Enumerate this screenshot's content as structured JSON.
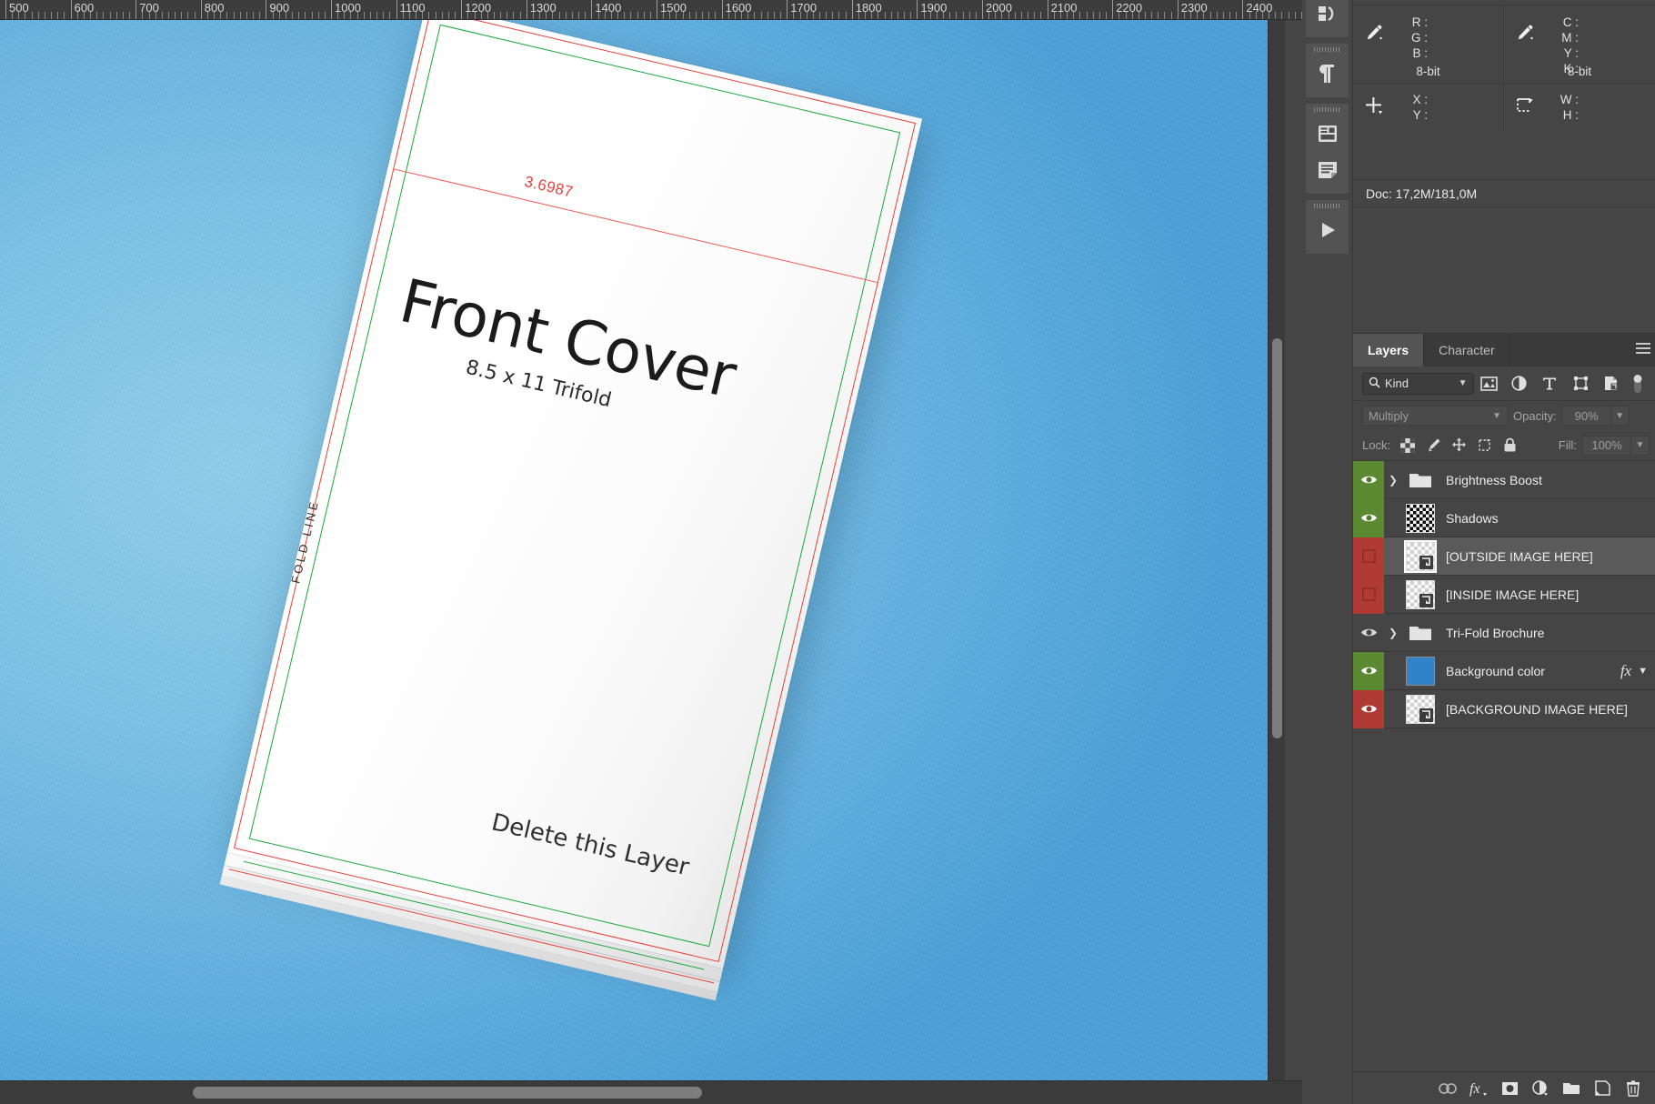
{
  "ruler": {
    "unit_start": 500,
    "unit_end": 2400,
    "step": 100,
    "labels": [
      "500",
      "600",
      "700",
      "800",
      "900",
      "1000",
      "1100",
      "1200",
      "1300",
      "1400",
      "1500",
      "1600",
      "1700",
      "1800",
      "1900",
      "2000",
      "2100",
      "2200",
      "2300",
      "2400"
    ]
  },
  "document": {
    "background_color": "#7cc0e4",
    "brochure": {
      "title": "Front Cover",
      "subtitle": "8.5 x 11 Trifold",
      "measure_label": "3.6987",
      "fold_line_label": "FOLD LINE",
      "delete_layer_note": "Delete this Layer",
      "guide_colors": {
        "bleed": "#e8413a",
        "safe": "#19a83c"
      }
    }
  },
  "icon_dock": {
    "items": [
      {
        "name": "history-icon",
        "label": "History"
      },
      {
        "name": "paragraph-icon",
        "label": "Paragraph"
      },
      {
        "name": "properties-icon",
        "label": "Properties"
      },
      {
        "name": "notes-icon",
        "label": "Notes"
      },
      {
        "name": "timeline-icon",
        "label": "Timeline"
      }
    ]
  },
  "info_panel": {
    "rgb": {
      "labels": [
        "R :",
        "G :",
        "B :"
      ],
      "depth": "8-bit"
    },
    "cmyk": {
      "labels": [
        "C :",
        "M :",
        "Y :",
        "K :"
      ],
      "depth": "8-bit"
    },
    "position": {
      "labels": [
        "X :",
        "Y :"
      ]
    },
    "dimensions": {
      "labels": [
        "W :",
        "H :"
      ]
    },
    "doc_size": "Doc: 17,2M/181,0M"
  },
  "layers_panel": {
    "tabs": [
      {
        "label": "Layers",
        "active": true
      },
      {
        "label": "Character",
        "active": false
      }
    ],
    "menu_icon": "panel-menu-icon",
    "filter": {
      "kind_label": "Kind",
      "search_icon": "search-icon",
      "type_filters": [
        "pixel-layer-icon",
        "adjustment-layer-icon",
        "type-layer-icon",
        "shape-layer-icon",
        "smart-object-icon"
      ],
      "toggle_icon": "filter-toggle-icon"
    },
    "blend": {
      "mode": "Multiply",
      "opacity_label": "Opacity:",
      "opacity_value": "90%",
      "fill_label": "Fill:",
      "fill_value": "100%"
    },
    "lock": {
      "label": "Lock:",
      "icons": [
        "lock-transparent-icon",
        "lock-image-icon",
        "lock-position-icon",
        "lock-artboard-icon",
        "lock-all-icon"
      ]
    },
    "layers": [
      {
        "name": "Brightness Boost",
        "visible": true,
        "eye_state": "green",
        "thumb": "folder",
        "expandable": true,
        "selected": false,
        "fx": false
      },
      {
        "name": "Shadows",
        "visible": true,
        "eye_state": "green",
        "thumb": "shadow",
        "expandable": false,
        "selected": false,
        "fx": false
      },
      {
        "name": "[OUTSIDE IMAGE HERE]",
        "visible": false,
        "eye_state": "red",
        "thumb": "placeholder",
        "expandable": false,
        "selected": true,
        "fx": false
      },
      {
        "name": "[INSIDE IMAGE HERE]",
        "visible": false,
        "eye_state": "red",
        "thumb": "placeholder",
        "expandable": false,
        "selected": false,
        "fx": false
      },
      {
        "name": "Tri-Fold Brochure",
        "visible": true,
        "eye_state": "plain",
        "thumb": "folder",
        "expandable": true,
        "selected": false,
        "fx": false
      },
      {
        "name": "Background color",
        "visible": true,
        "eye_state": "green",
        "thumb": "solid-blue",
        "expandable": false,
        "selected": false,
        "fx": true,
        "fx_label": "fx"
      },
      {
        "name": "[BACKGROUND IMAGE HERE]",
        "visible": true,
        "eye_state": "red",
        "thumb": "placeholder",
        "expandable": false,
        "selected": false,
        "fx": false
      }
    ],
    "footer_icons": [
      "link-layers-icon",
      "layer-style-fx-icon",
      "add-mask-icon",
      "adjustment-layer-icon",
      "new-group-icon",
      "new-layer-icon",
      "delete-layer-icon"
    ]
  }
}
